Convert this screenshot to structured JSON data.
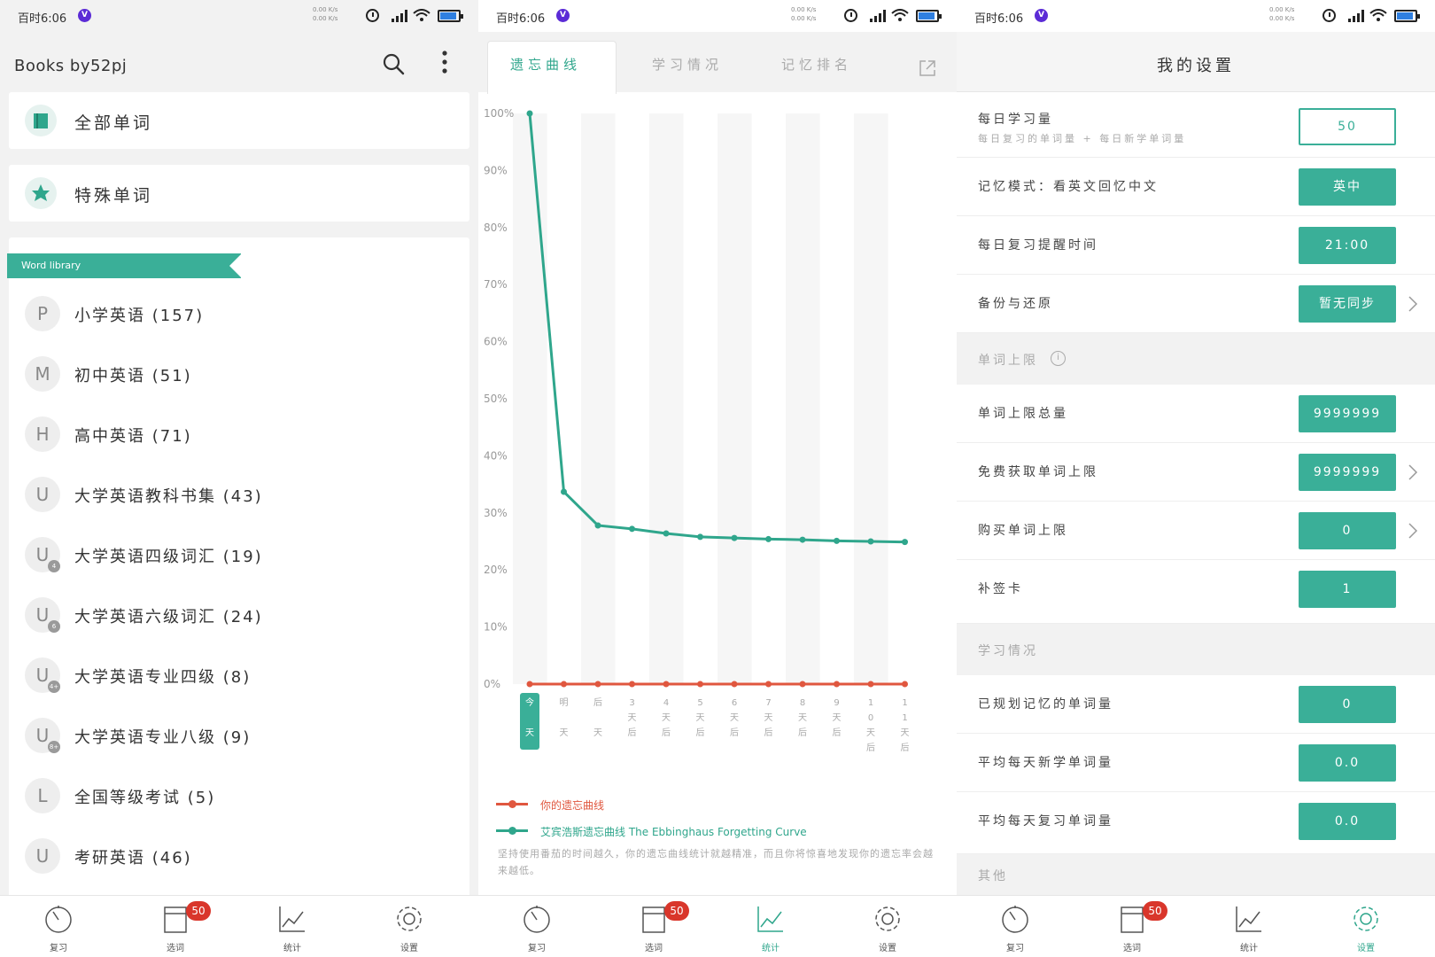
{
  "status": {
    "time": "百时6:06",
    "net_line1": "0.00 K/s",
    "net_line2": "0.00 K/s"
  },
  "colors": {
    "accent": "#3aaf98",
    "red": "#e0573f",
    "badge": "#d9362b"
  },
  "panel1": {
    "title": "Books by52pj",
    "all_words": "全部单词",
    "special_words": "特殊单词",
    "library_banner": "Word library",
    "libraries": [
      {
        "letter": "P",
        "sub": "",
        "name": "小学英语 (157)"
      },
      {
        "letter": "M",
        "sub": "",
        "name": "初中英语 (51)"
      },
      {
        "letter": "H",
        "sub": "",
        "name": "高中英语 (71)"
      },
      {
        "letter": "U",
        "sub": "",
        "name": "大学英语教科书集 (43)"
      },
      {
        "letter": "U",
        "sub": "4",
        "name": "大学英语四级词汇 (19)"
      },
      {
        "letter": "U",
        "sub": "6",
        "name": "大学英语六级词汇 (24)"
      },
      {
        "letter": "U",
        "sub": "4+",
        "name": "大学英语专业四级 (8)"
      },
      {
        "letter": "U",
        "sub": "8+",
        "name": "大学英语专业八级 (9)"
      },
      {
        "letter": "L",
        "sub": "",
        "name": "全国等级考试 (5)"
      },
      {
        "letter": "U",
        "sub": "",
        "name": "考研英语 (46)"
      }
    ]
  },
  "tabbar": {
    "review": "复习",
    "select": "选词",
    "stats": "统计",
    "settings": "设置",
    "badge": "50"
  },
  "panel2": {
    "tabs": [
      "遗忘曲线",
      "学习情况",
      "记忆排名"
    ],
    "legend_yours": "你的遗忘曲线",
    "legend_ebbinghaus": "艾宾浩斯遗忘曲线 The Ebbinghaus Forgetting Curve",
    "note": "坚持使用番茄的时间越久，你的遗忘曲线统计就越精准，而且你将惊喜地发现你的遗忘率会越来越低。"
  },
  "chart_data": {
    "type": "line",
    "categories": [
      "今天",
      "明天",
      "后天",
      "3天后",
      "4天后",
      "5天后",
      "6天后",
      "7天后",
      "8天后",
      "9天后",
      "10天后",
      "11天后"
    ],
    "y_ticks": [
      "100%",
      "90%",
      "80%",
      "70%",
      "60%",
      "50%",
      "40%",
      "30%",
      "20%",
      "10%",
      "0%"
    ],
    "ylim": [
      0,
      100
    ],
    "series": [
      {
        "name": "你的遗忘曲线",
        "color": "#e0573f",
        "values": [
          0,
          0,
          0,
          0,
          0,
          0,
          0,
          0,
          0,
          0,
          0,
          0
        ]
      },
      {
        "name": "艾宾浩斯遗忘曲线 The Ebbinghaus Forgetting Curve",
        "color": "#2fa68c",
        "values": [
          100,
          33.7,
          27.8,
          27.2,
          26.4,
          25.8,
          25.6,
          25.4,
          25.3,
          25.1,
          25.0,
          24.9
        ]
      }
    ]
  },
  "panel3": {
    "title": "我的设置",
    "daily_study": "每日学习量",
    "daily_study_sub": "每日复习的单词量 + 每日新学单词量",
    "daily_study_value": "50",
    "memory_mode": "记忆模式：看英文回忆中文",
    "memory_mode_value": "英中",
    "reminder_time": "每日复习提醒时间",
    "reminder_value": "21:00",
    "backup": "备份与还原",
    "backup_value": "暂无同步",
    "group_limit": "单词上限",
    "limit_total": "单词上限总量",
    "limit_total_value": "9999999",
    "limit_free": "免费获取单词上限",
    "limit_free_value": "9999999",
    "limit_buy": "购买单词上限",
    "limit_buy_value": "0",
    "makeup_card": "补签卡",
    "makeup_value": "1",
    "group_study": "学习情况",
    "planned": "已规划记忆的单词量",
    "planned_value": "0",
    "avg_new": "平均每天新学单词量",
    "avg_new_value": "0.0",
    "avg_review": "平均每天复习单词量",
    "avg_review_value": "0.0",
    "group_other": "其他"
  }
}
